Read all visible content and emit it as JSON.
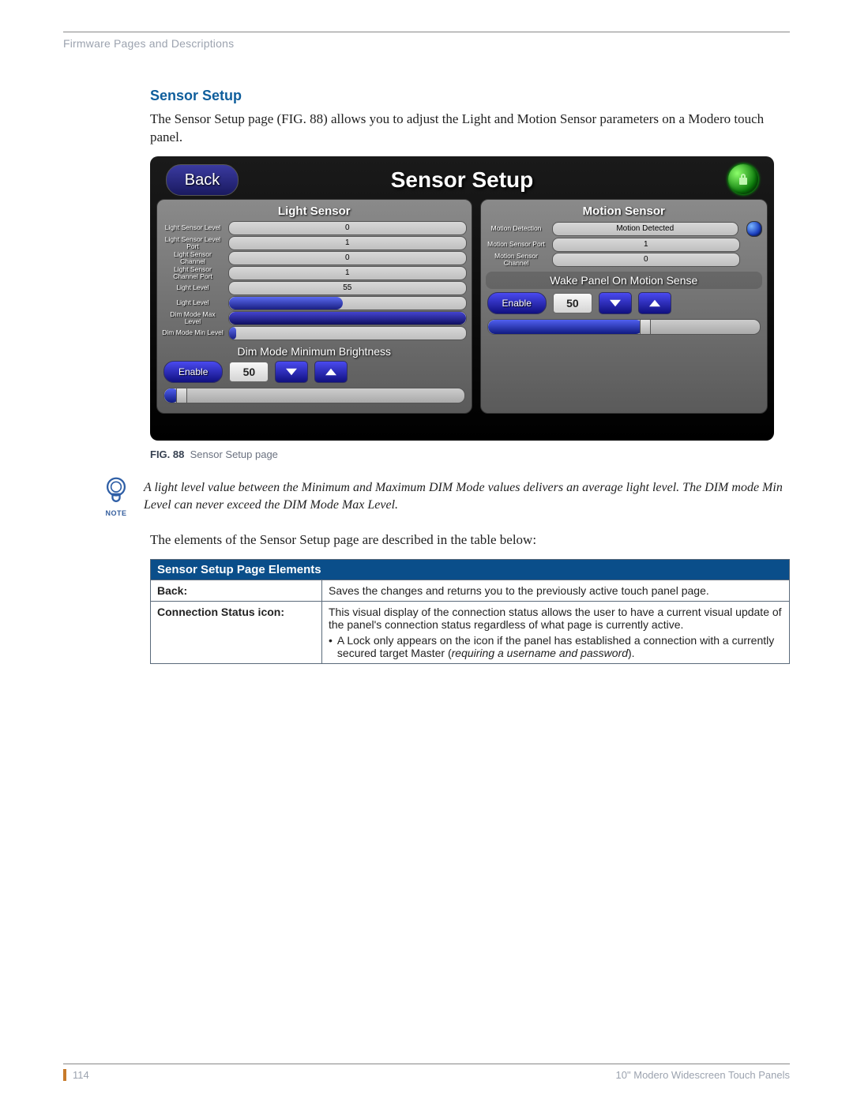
{
  "breadcrumb": "Firmware Pages and Descriptions",
  "section_title": "Sensor Setup",
  "intro": "The Sensor Setup page (FIG. 88) allows you to adjust the Light and Motion Sensor parameters on a Modero touch panel.",
  "figure_label": "FIG. 88",
  "figure_desc": "Sensor Setup page",
  "note_text": "A light level value between the Minimum and Maximum DIM Mode values delivers an average light level. The DIM mode Min Level can never exceed the DIM Mode Max Level.",
  "note_label": "NOTE",
  "table_intro": "The elements of the Sensor Setup page are described in the table below:",
  "table_header": "Sensor Setup Page Elements",
  "rows": [
    {
      "key": "Back:",
      "desc": "Saves the changes and returns you to the previously active touch panel page."
    },
    {
      "key": "Connection Status icon:",
      "desc": "This visual display of the connection status allows the user to have a current visual update of the panel's connection status regardless of what page is currently active.",
      "bullet_prefix": "A Lock only appears on the icon if the panel has established a connection with a currently secured target Master (",
      "bullet_italic": "requiring a username and password",
      "bullet_suffix": ")."
    }
  ],
  "footer": {
    "page_num": "114",
    "title": "10\" Modero Widescreen Touch Panels"
  },
  "panel": {
    "back": "Back",
    "title": "Sensor Setup",
    "light_head": "Light Sensor",
    "light": [
      {
        "label": "Light Sensor Level",
        "value": "0"
      },
      {
        "label": "Light Sensor Level Port",
        "value": "1"
      },
      {
        "label": "Light Sensor Channel",
        "value": "0"
      },
      {
        "label": "Light Sensor Channel Port",
        "value": "1"
      },
      {
        "label": "Light Level",
        "value": "55"
      }
    ],
    "light_level_label": "Light Level",
    "dim_max_label": "Dim Mode Max Level",
    "dim_min_label": "Dim Mode Min Level",
    "dim_head": "Dim Mode Minimum Brightness",
    "dim_enable": "Enable",
    "dim_value": "50",
    "motion_head": "Motion Sensor",
    "motion_detect_label": "Motion Detection",
    "motion_detect_value": "Motion Detected",
    "motion": [
      {
        "label": "Motion Sensor Port",
        "value": "1"
      },
      {
        "label": "Motion Sensor Channel",
        "value": "0"
      }
    ],
    "wake_head": "Wake Panel On Motion Sense",
    "wake_enable": "Enable",
    "wake_value": "50"
  }
}
